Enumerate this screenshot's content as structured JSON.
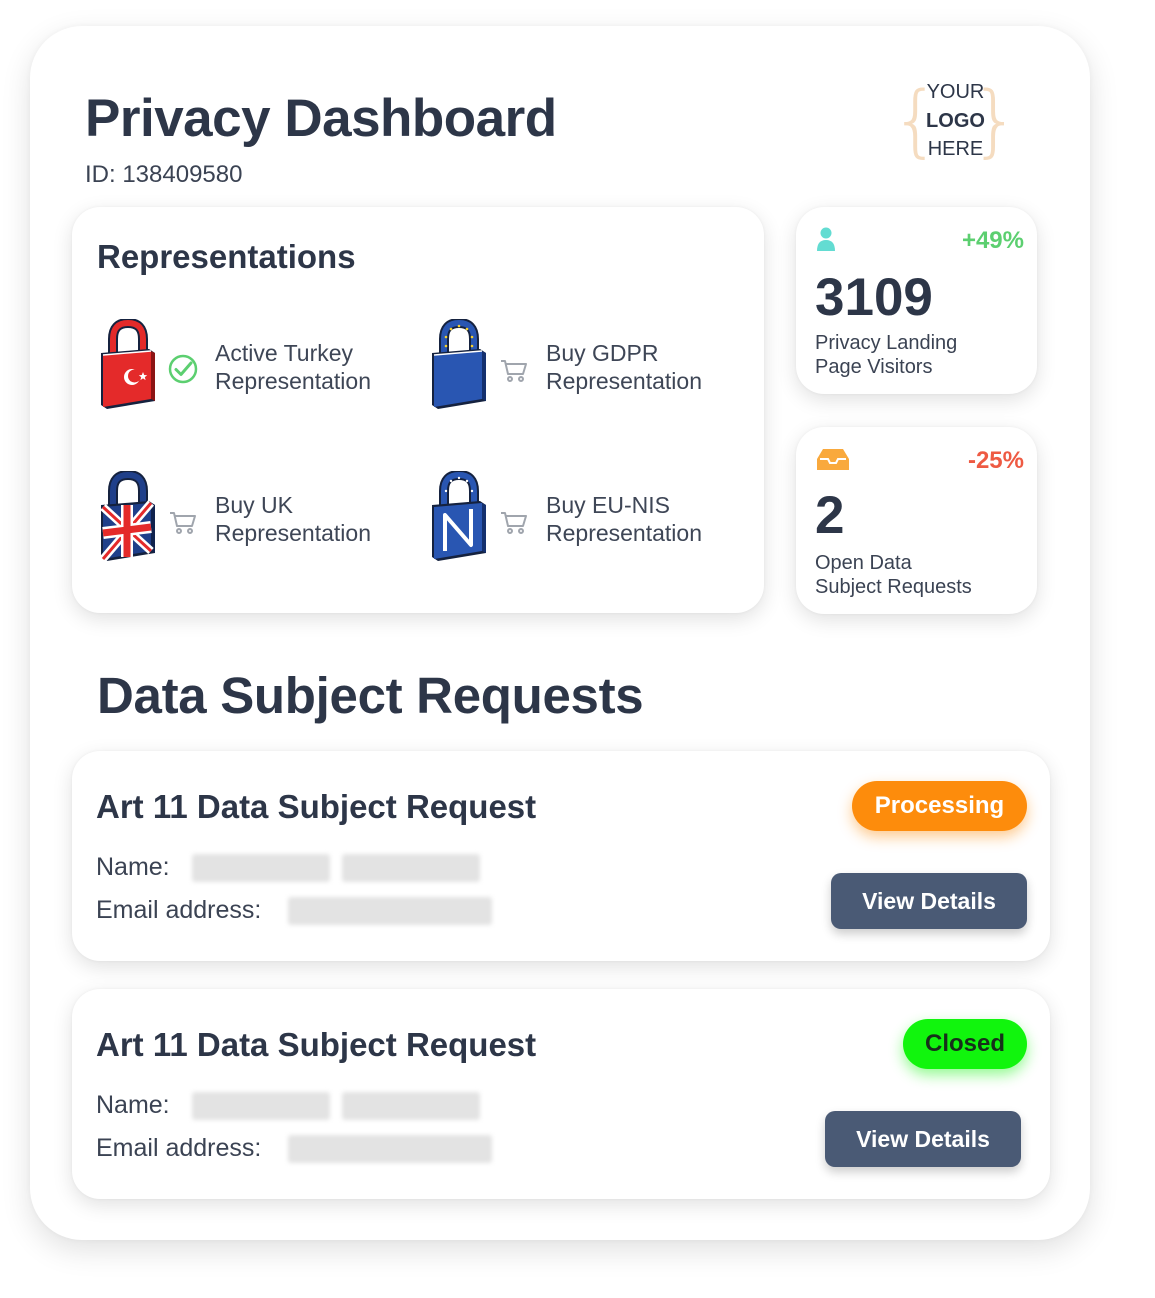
{
  "header": {
    "title": "Privacy Dashboard",
    "id_text": "ID: 138409580",
    "logo": {
      "line1": "YOUR",
      "line2": "LOGO",
      "line3": "HERE"
    }
  },
  "representations": {
    "title": "Representations",
    "items": [
      {
        "label_line1": "Active Turkey",
        "label_line2": "Representation",
        "status": "active",
        "status_icon": "check-circle-icon",
        "lock": "turkey-flag-lock-icon"
      },
      {
        "label_line1": "Buy GDPR",
        "label_line2": "Representation",
        "status": "buy",
        "status_icon": "cart-icon",
        "lock": "eu-flag-lock-icon"
      },
      {
        "label_line1": "Buy UK",
        "label_line2": "Representation",
        "status": "buy",
        "status_icon": "cart-icon",
        "lock": "uk-flag-lock-icon"
      },
      {
        "label_line1": "Buy EU-NIS",
        "label_line2": "Representation",
        "status": "buy",
        "status_icon": "cart-icon",
        "lock": "eu-nis-lock-icon"
      }
    ]
  },
  "stats": [
    {
      "icon": "user-icon",
      "delta": "+49%",
      "delta_color": "#5ccf70",
      "value": "3109",
      "label_line1": "Privacy Landing",
      "label_line2": "Page Visitors"
    },
    {
      "icon": "inbox-icon",
      "delta": "-25%",
      "delta_color": "#ee5a43",
      "value": "2",
      "label_line1": "Open Data",
      "label_line2": "Subject Requests"
    }
  ],
  "dsr": {
    "heading": "Data Subject Requests",
    "requests": [
      {
        "title": "Art 11 Data Subject Request",
        "status": "Processing",
        "name_label": "Name:",
        "email_label": "Email address:",
        "button": "View Details"
      },
      {
        "title": "Art 11 Data Subject Request",
        "status": "Closed",
        "name_label": "Name:",
        "email_label": "Email address:",
        "button": "View Details"
      }
    ]
  },
  "colors": {
    "primary_text": "#2d3648",
    "button": "#4a5a75",
    "processing": "#fd8c0c",
    "closed": "#11f50d",
    "accent_teal": "#63dcd2",
    "accent_orange": "#f9a93d"
  }
}
